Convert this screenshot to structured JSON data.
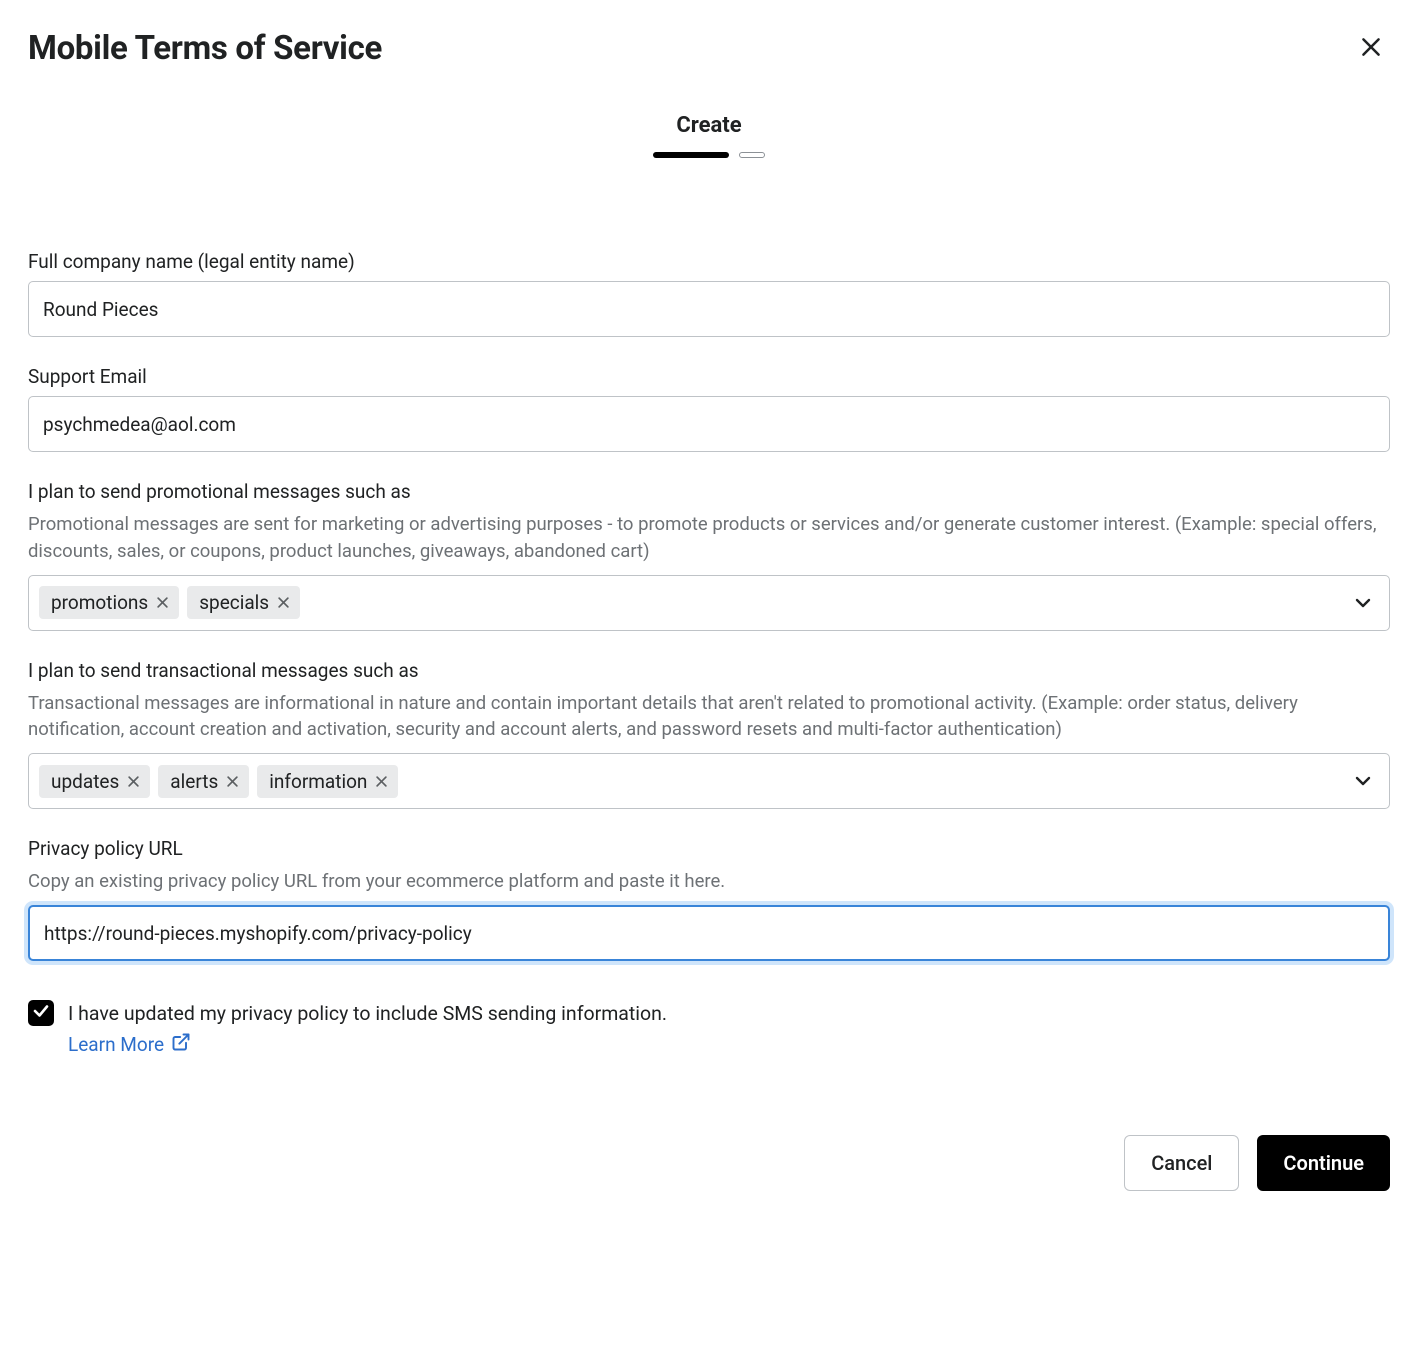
{
  "header": {
    "title": "Mobile Terms of Service",
    "subtitle": "Create"
  },
  "fields": {
    "company": {
      "label": "Full company name (legal entity name)",
      "value": "Round Pieces"
    },
    "email": {
      "label": "Support Email",
      "value": "psychmedea@aol.com"
    },
    "promo": {
      "label": "I plan to send promotional messages such as",
      "help": "Promotional messages are sent for marketing or advertising purposes - to promote products or services and/or generate customer interest. (Example: special offers, discounts, sales, or coupons, product launches, giveaways, abandoned cart)",
      "tags": [
        "promotions",
        "specials"
      ]
    },
    "trans": {
      "label": "I plan to send transactional messages such as",
      "help": "Transactional messages are informational in nature and contain important details that aren't related to promotional activity. (Example: order status, delivery notification, account creation and activation, security and account alerts, and password resets and multi-factor authentication)",
      "tags": [
        "updates",
        "alerts",
        "information"
      ]
    },
    "privacy": {
      "label": "Privacy policy URL",
      "help": "Copy an existing privacy policy URL from your ecommerce platform and paste it here.",
      "value": "https://round-pieces.myshopify.com/privacy-policy"
    },
    "consent": {
      "text": "I have updated my privacy policy to include SMS sending information.",
      "link": "Learn More"
    }
  },
  "footer": {
    "cancel": "Cancel",
    "continue": "Continue"
  }
}
